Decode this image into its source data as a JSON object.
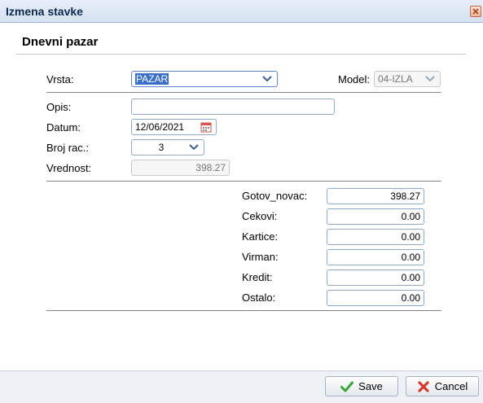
{
  "window": {
    "title": "Izmena stavke"
  },
  "section": {
    "title": "Dnevni pazar"
  },
  "form": {
    "vrsta": {
      "label": "Vrsta:",
      "value": "PAZAR"
    },
    "model": {
      "label": "Model:",
      "value": "04-IZLA"
    },
    "opis": {
      "label": "Opis:",
      "value": ""
    },
    "datum": {
      "label": "Datum:",
      "value": "12/06/2021"
    },
    "broj_rac": {
      "label": "Broj rac.:",
      "value": "3"
    },
    "vrednost": {
      "label": "Vrednost:",
      "value": "398.27"
    }
  },
  "payments": [
    {
      "label": "Gotov_novac:",
      "value": "398.27"
    },
    {
      "label": "Cekovi:",
      "value": "0.00"
    },
    {
      "label": "Kartice:",
      "value": "0.00"
    },
    {
      "label": "Virman:",
      "value": "0.00"
    },
    {
      "label": "Kredit:",
      "value": "0.00"
    },
    {
      "label": "Ostalo:",
      "value": "0.00"
    }
  ],
  "footer": {
    "save_label": "Save",
    "cancel_label": "Cancel"
  },
  "colors": {
    "title_text": "#0f2a4e",
    "selection": "#3a6fc7",
    "save_icon": "#3aa63a",
    "cancel_icon": "#d33a2a"
  },
  "icons": [
    "close-icon",
    "chevron-down-icon",
    "calendar-icon",
    "check-icon",
    "cancel-x-icon"
  ]
}
